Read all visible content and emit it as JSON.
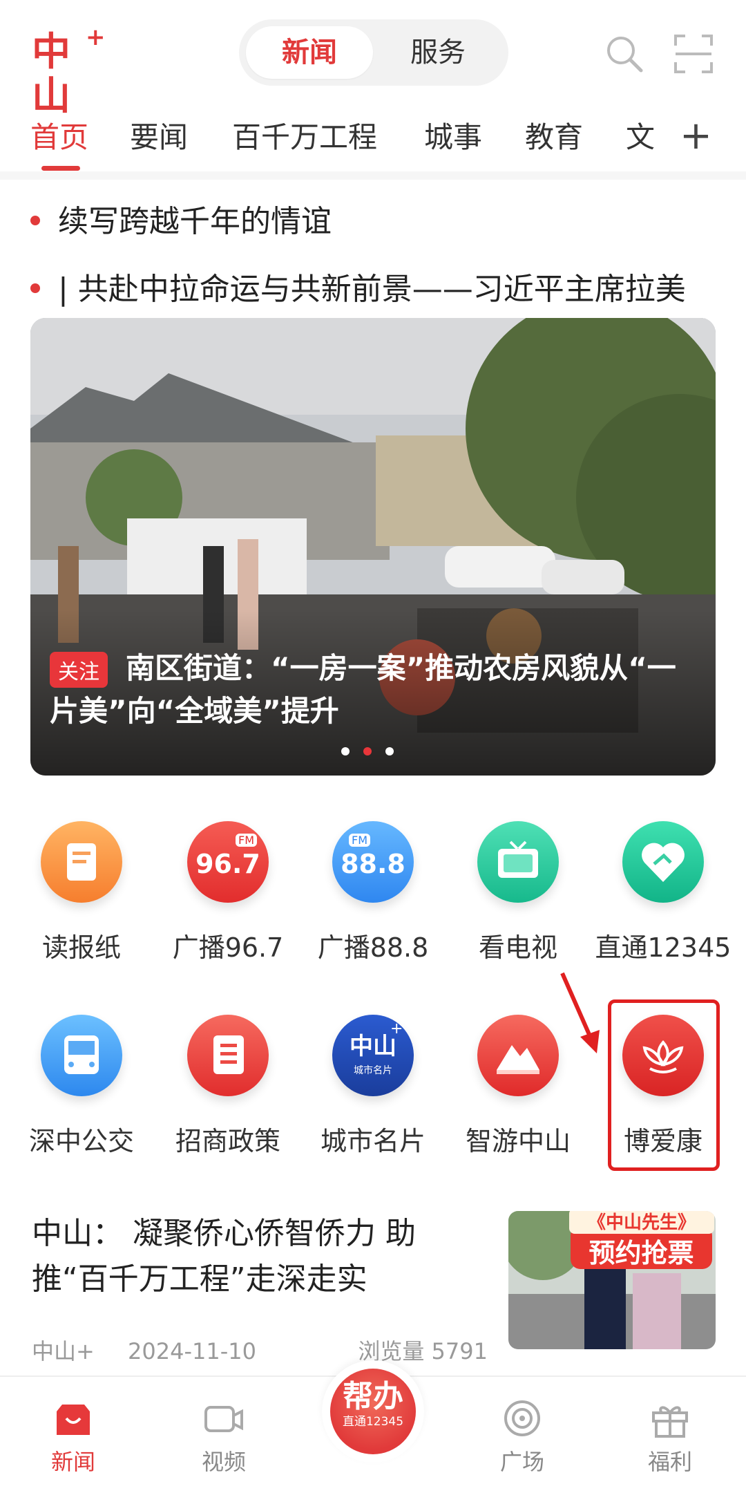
{
  "header": {
    "logo_text": "中山",
    "logo_plus": "+",
    "segments": [
      "新闻",
      "服务"
    ],
    "search_icon": "search-icon",
    "scan_icon": "scan-icon"
  },
  "tabs": [
    "首页",
    "要闻",
    "百千万工程",
    "城事",
    "教育",
    "文"
  ],
  "tabs_add": "+",
  "headlines": [
    "续写跨越千年的情谊",
    "| 共赴中拉命运与共新前景——习近平主席拉美"
  ],
  "banner": {
    "tag": "关注",
    "title": "南区街道：“一房一案”推动农房风貌从“一片美”向“全域美”提升"
  },
  "grid": [
    {
      "label": "读报纸",
      "icon": "newspaper-icon"
    },
    {
      "label": "广播96.7",
      "icon": "radio-96-7-icon",
      "badge": "96.7",
      "fm": "FM"
    },
    {
      "label": "广播88.8",
      "icon": "radio-88-8-icon",
      "badge": "88.8",
      "fm": "FM"
    },
    {
      "label": "看电视",
      "icon": "tv-icon"
    },
    {
      "label": "直通12345",
      "icon": "heart-hand-icon"
    },
    {
      "label": "深中公交",
      "icon": "bus-icon"
    },
    {
      "label": "招商政策",
      "icon": "policy-book-icon"
    },
    {
      "label": "城市名片",
      "icon": "city-card-icon",
      "inner_top": "中山",
      "inner_plus": "+",
      "inner_sub": "城市名片"
    },
    {
      "label": "智游中山",
      "icon": "mountain-icon"
    },
    {
      "label": "博爱康",
      "icon": "lotus-icon"
    }
  ],
  "news": {
    "title": "中山： 凝聚侨心侨智侨力 助推“百千万工程”走深走实",
    "source": "中山+",
    "date": "2024-11-10",
    "views": "浏览量 5791",
    "thumb_top": "《中山先生》",
    "thumb_main": "预约抢票"
  },
  "bottom_nav": [
    {
      "label": "新闻",
      "icon": "news-bag-icon"
    },
    {
      "label": "视频",
      "icon": "video-camera-icon"
    },
    {
      "label": "广场",
      "icon": "target-icon"
    },
    {
      "label": "福利",
      "icon": "gift-icon"
    }
  ],
  "center_button": {
    "main": "帮办",
    "sub": "直通12345"
  }
}
